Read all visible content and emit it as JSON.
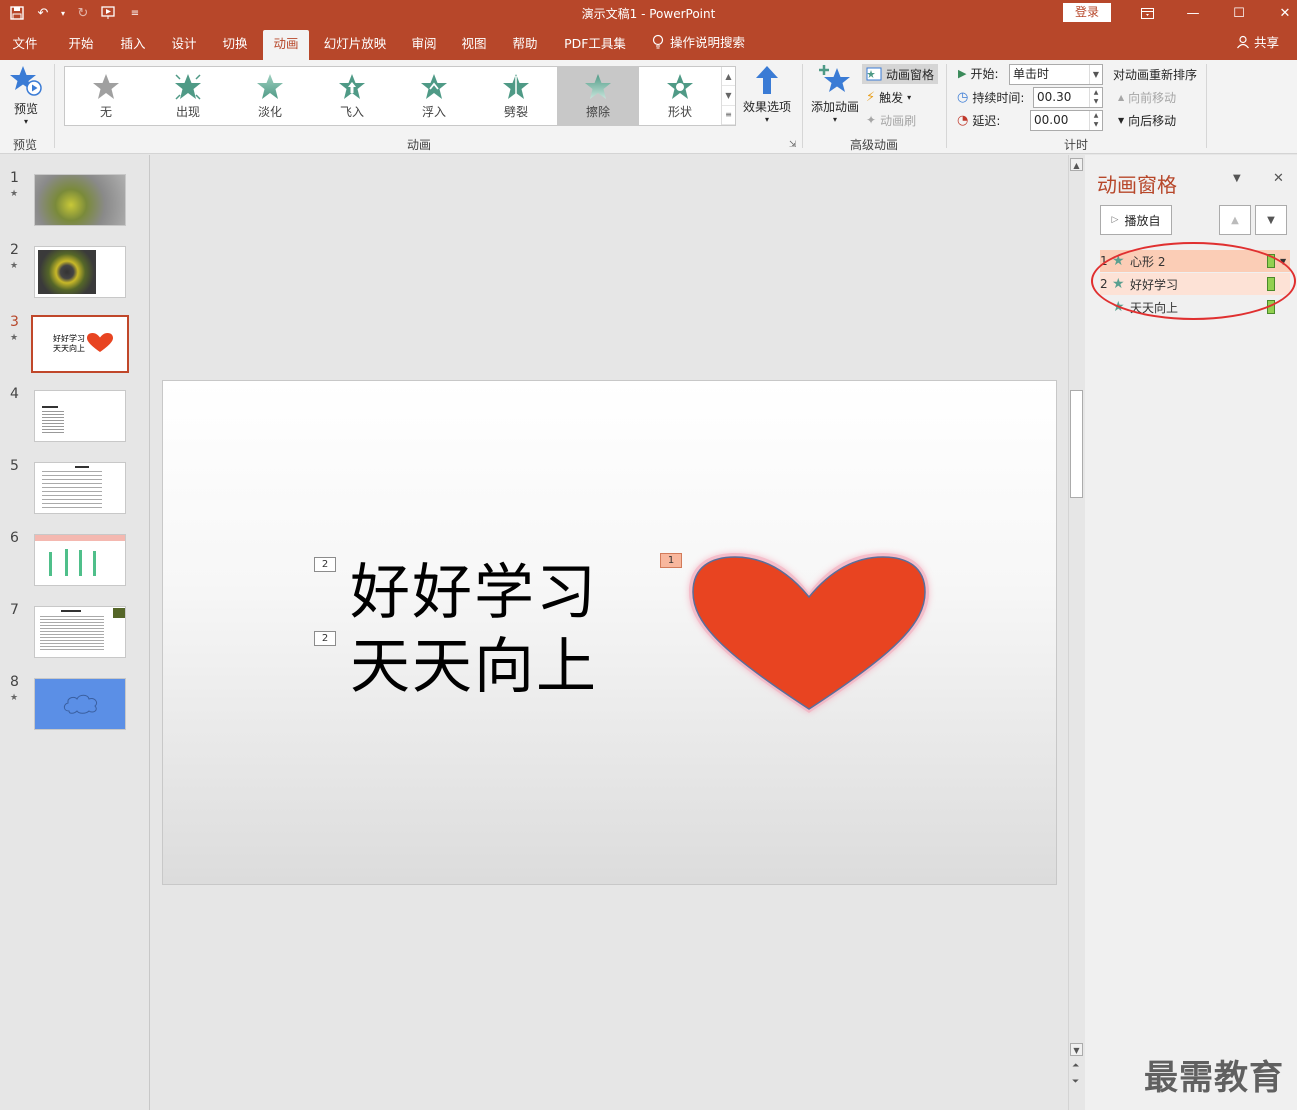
{
  "window": {
    "title": "演示文稿1  -  PowerPoint",
    "login": "登录"
  },
  "tabs": [
    "文件",
    "开始",
    "插入",
    "设计",
    "切换",
    "动画",
    "幻灯片放映",
    "审阅",
    "视图",
    "帮助",
    "PDF工具集"
  ],
  "active_tab": "动画",
  "tell_me": "操作说明搜索",
  "share": "共享",
  "ribbon": {
    "preview": {
      "label": "预览",
      "group": "预览"
    },
    "animations": {
      "group": "动画",
      "items": [
        "无",
        "出现",
        "淡化",
        "飞入",
        "浮入",
        "劈裂",
        "擦除",
        "形状"
      ],
      "selected": "擦除",
      "effect_options": "效果选项"
    },
    "advanced": {
      "group": "高级动画",
      "add_animation": "添加动画",
      "animation_pane": "动画窗格",
      "trigger": "触发",
      "painter": "动画刷"
    },
    "timing": {
      "group": "计时",
      "start_label": "开始:",
      "start_value": "单击时",
      "duration_label": "持续时间:",
      "duration_value": "00.30",
      "delay_label": "延迟:",
      "delay_value": "00.00",
      "reorder_title": "对动画重新排序",
      "move_earlier": "向前移动",
      "move_later": "向后移动"
    }
  },
  "thumbnails": [
    {
      "num": "1",
      "star": "★"
    },
    {
      "num": "2",
      "star": "★"
    },
    {
      "num": "3",
      "star": "★",
      "text_line1": "好好学习",
      "text_line2": "天天向上"
    },
    {
      "num": "4",
      "star": ""
    },
    {
      "num": "5",
      "star": ""
    },
    {
      "num": "6",
      "star": ""
    },
    {
      "num": "7",
      "star": ""
    },
    {
      "num": "8",
      "star": "★"
    }
  ],
  "slide": {
    "line1": "好好学习",
    "line2": "天天向上",
    "tag_text1": "2",
    "tag_text2": "2",
    "tag_heart": "1",
    "heart_color": "#e84421"
  },
  "anim_pane": {
    "title": "动画窗格",
    "play_from": "播放自",
    "items": [
      {
        "num": "1",
        "label": "心形 2"
      },
      {
        "num": "2",
        "label": "好好学习"
      },
      {
        "num": "",
        "label": "天天向上"
      }
    ]
  },
  "watermark": "最需教育",
  "colors": {
    "accent": "#b7472a",
    "selected_row": "#fbcdb6"
  }
}
